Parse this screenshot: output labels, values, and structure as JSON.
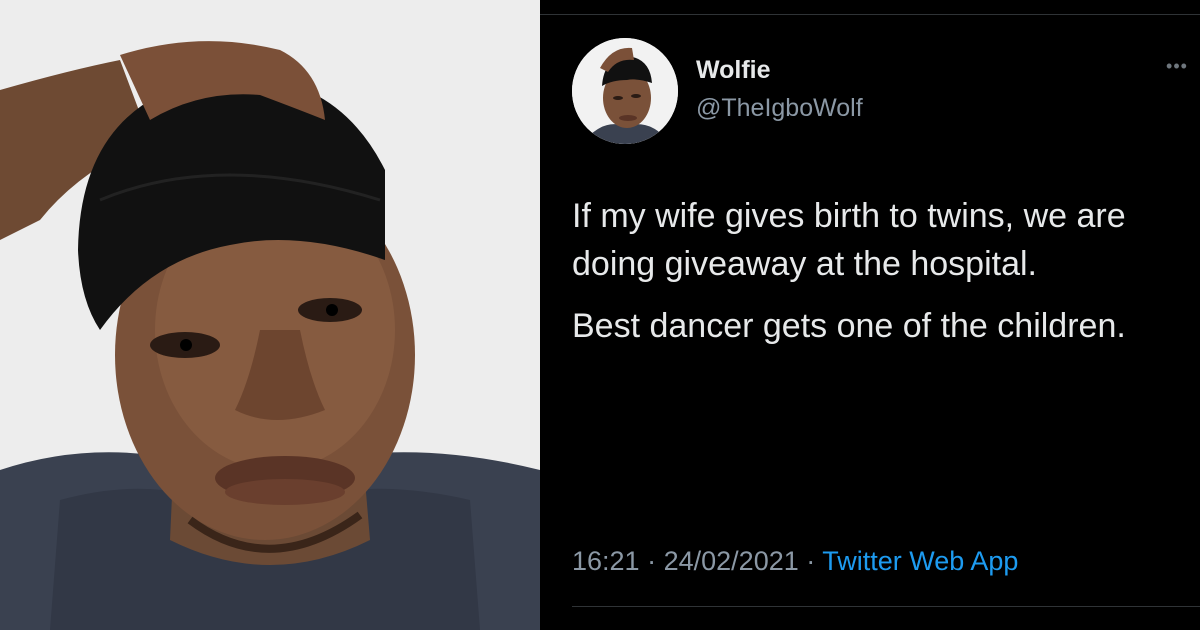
{
  "photo": {
    "icon": "person-photo"
  },
  "tweet": {
    "display_name": "Wolfie",
    "handle": "@TheIgboWolf",
    "more_icon": "more-horizontal-icon",
    "paragraphs": [
      "If my wife gives birth to twins, we are doing giveaway at the hospital.",
      "Best dancer gets one of the children."
    ],
    "time": "16:21",
    "separator": "·",
    "date": "24/02/2021",
    "source_app": "Twitter Web App"
  },
  "colors": {
    "background": "#000000",
    "text_primary": "#e7e9ea",
    "text_secondary": "#8b98a5",
    "link": "#1d9bf0",
    "divider": "#2f3336"
  }
}
